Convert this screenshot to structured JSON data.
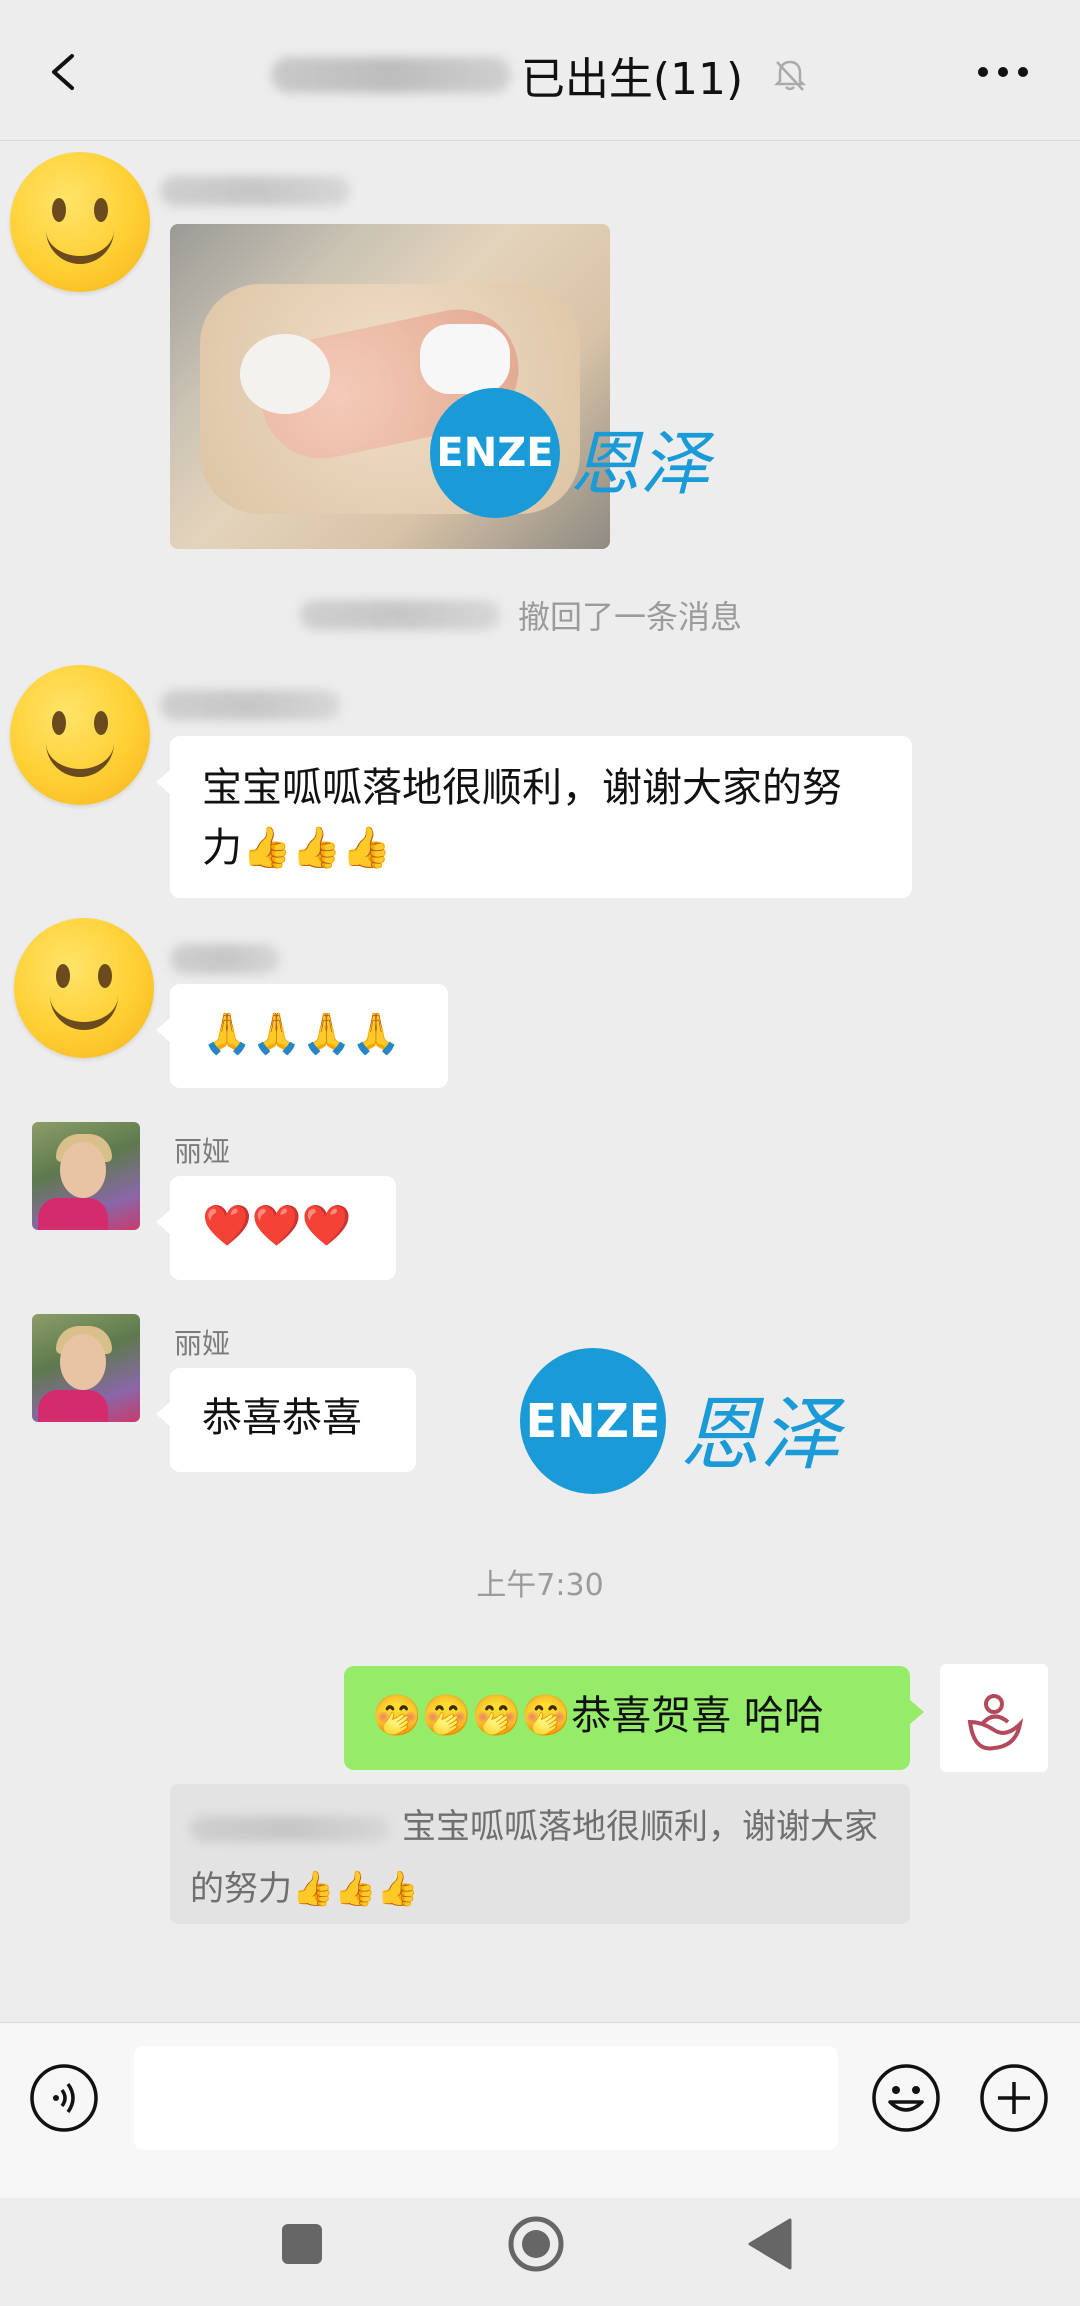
{
  "header": {
    "title": "已出生(11)"
  },
  "messages": {
    "recall_notice": "撤回了一条消息",
    "msg_thanks": "宝宝呱呱落地很顺利，谢谢大家的努力👍👍👍",
    "msg_pray": "🙏🙏🙏🙏",
    "sender_liya_1": "丽娅",
    "msg_hearts": "❤️❤️❤️",
    "sender_liya_2": "丽娅",
    "msg_congrats": "恭喜恭喜",
    "timestamp_1": "上午7:30",
    "self_msg": "🤭🤭🤭🤭恭喜贺喜 哈哈",
    "quote_text": "宝宝呱呱落地很顺利，谢谢大家的努力👍👍👍"
  },
  "watermark": {
    "latin": "ENZE",
    "chinese": "恩泽"
  },
  "icons": {
    "back": "back-icon",
    "mute": "bell-muted-icon",
    "more": "more-icon",
    "voice": "voice-icon",
    "emoji": "emoji-icon",
    "add": "plus-icon",
    "nav_recent": "square-icon",
    "nav_home": "circle-icon",
    "nav_back": "triangle-icon"
  },
  "colors": {
    "background": "#ededed",
    "self_bubble": "#95ec69",
    "watermark_blue": "#1a9bd8"
  }
}
